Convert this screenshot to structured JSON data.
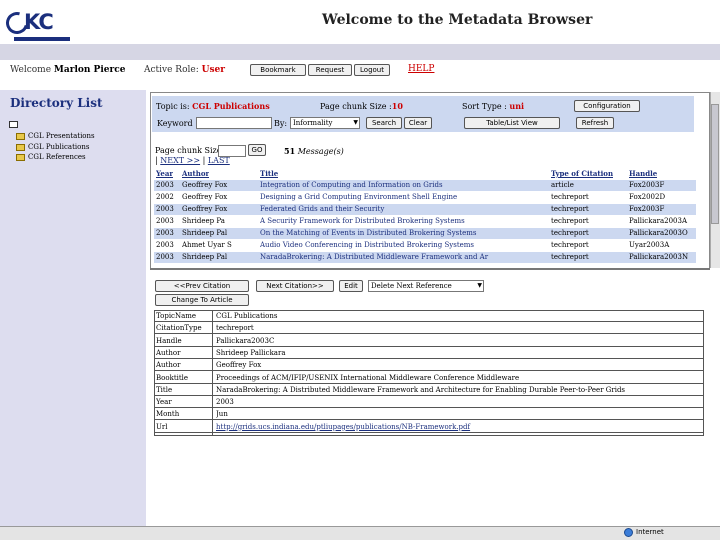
{
  "header": {
    "title": "Welcome to the Metadata Browser",
    "welcome_label": "Welcome",
    "user_name": "Marlon Pierce",
    "active_role_label": "Active Role:",
    "active_role_value": "User",
    "buttons": [
      "Bookmark",
      "Request",
      "Logout"
    ],
    "help": "HELP"
  },
  "sidebar": {
    "title": "Directory List",
    "items": [
      "CGL Presentations",
      "CGL Publications",
      "CGL References"
    ]
  },
  "search": {
    "topic_label": "Topic is:",
    "topic_value": "CGL Publications",
    "chunk_label": "Page chunk Size :",
    "chunk_value": "10",
    "sort_label": "Sort Type :",
    "sort_value": "uni",
    "config_button": "Configuration",
    "keyword_label": "Keyword",
    "by_label": "By:",
    "by_value": "Informality",
    "search_button": "Search",
    "clear_button": "Clear",
    "table_view_button": "Table/List View",
    "refresh_button": "Refresh"
  },
  "paging": {
    "chunk_label": "Page chunk Size :",
    "go_button": "GO",
    "message_count": "51",
    "message_label": "Message(s)",
    "next_link": "NEXT >>",
    "last_link": "LAST"
  },
  "messages": {
    "columns": [
      "Year",
      "Author",
      "Title",
      "Type of Citation",
      "Handle"
    ],
    "rows": [
      [
        "2003",
        "Geoffrey Fox",
        "Integration of Computing and Information on Grids",
        "article",
        "Fox2003F"
      ],
      [
        "2002",
        "Geoffrey Fox",
        "Designing a Grid Computing Environment Shell Engine",
        "techreport",
        "Fox2002D"
      ],
      [
        "2003",
        "Geoffrey Fox",
        "Federated Grids and their Security",
        "techreport",
        "Fox2003F"
      ],
      [
        "2003",
        "Shrideep Pa",
        "A Security Framework for Distributed Brokering Systems",
        "techreport",
        "Pallickara2003A"
      ],
      [
        "2003",
        "Shrideep Pal",
        "On the Matching of Events in Distributed Brokering Systems",
        "techreport",
        "Pallickara2003O"
      ],
      [
        "2003",
        "Ahmet Uyar S",
        "Audio Video Conferencing in Distributed Brokering Systems",
        "techreport",
        "Uyar2003A"
      ],
      [
        "2003",
        "Shrideep Pal",
        "NaradaBrokering: A Distributed Middleware Framework and Ar",
        "techreport",
        "Pallickara2003N"
      ]
    ]
  },
  "actions": {
    "prev_button": "<<Prev Citation",
    "next_button": "Next Citation>>",
    "edit_button": "Edit",
    "select_value": "Delete Next Reference",
    "change_button": "Change To Article"
  },
  "detail": {
    "rows": [
      [
        "TopicName",
        "CGL Publications"
      ],
      [
        "CitationType",
        "techreport"
      ],
      [
        "Handle",
        "Pallickara2003C"
      ],
      [
        "Author",
        "Shrideep Pallickara"
      ],
      [
        "Author",
        "Geoffrey Fox"
      ],
      [
        "Booktitle",
        "Proceedings of ACM/IFIP/USENIX International Middleware Conference Middleware"
      ],
      [
        "Title",
        "NaradaBrokering: A Distributed Middleware Framework and Architecture for Enabling Durable Peer-to-Peer Grids"
      ],
      [
        "Year",
        "2003"
      ],
      [
        "Month",
        "Jun"
      ],
      [
        "Url",
        "http://grids.ucs.indiana.edu/ptliupages/publications/NB-Framework.pdf"
      ]
    ]
  },
  "status": {
    "zone": "Internet"
  },
  "colors": {
    "brand": "#1b2f7d",
    "accent_red": "#cc0000",
    "row_alt": "#ccd8f0",
    "sidebar": "#ddddef"
  }
}
